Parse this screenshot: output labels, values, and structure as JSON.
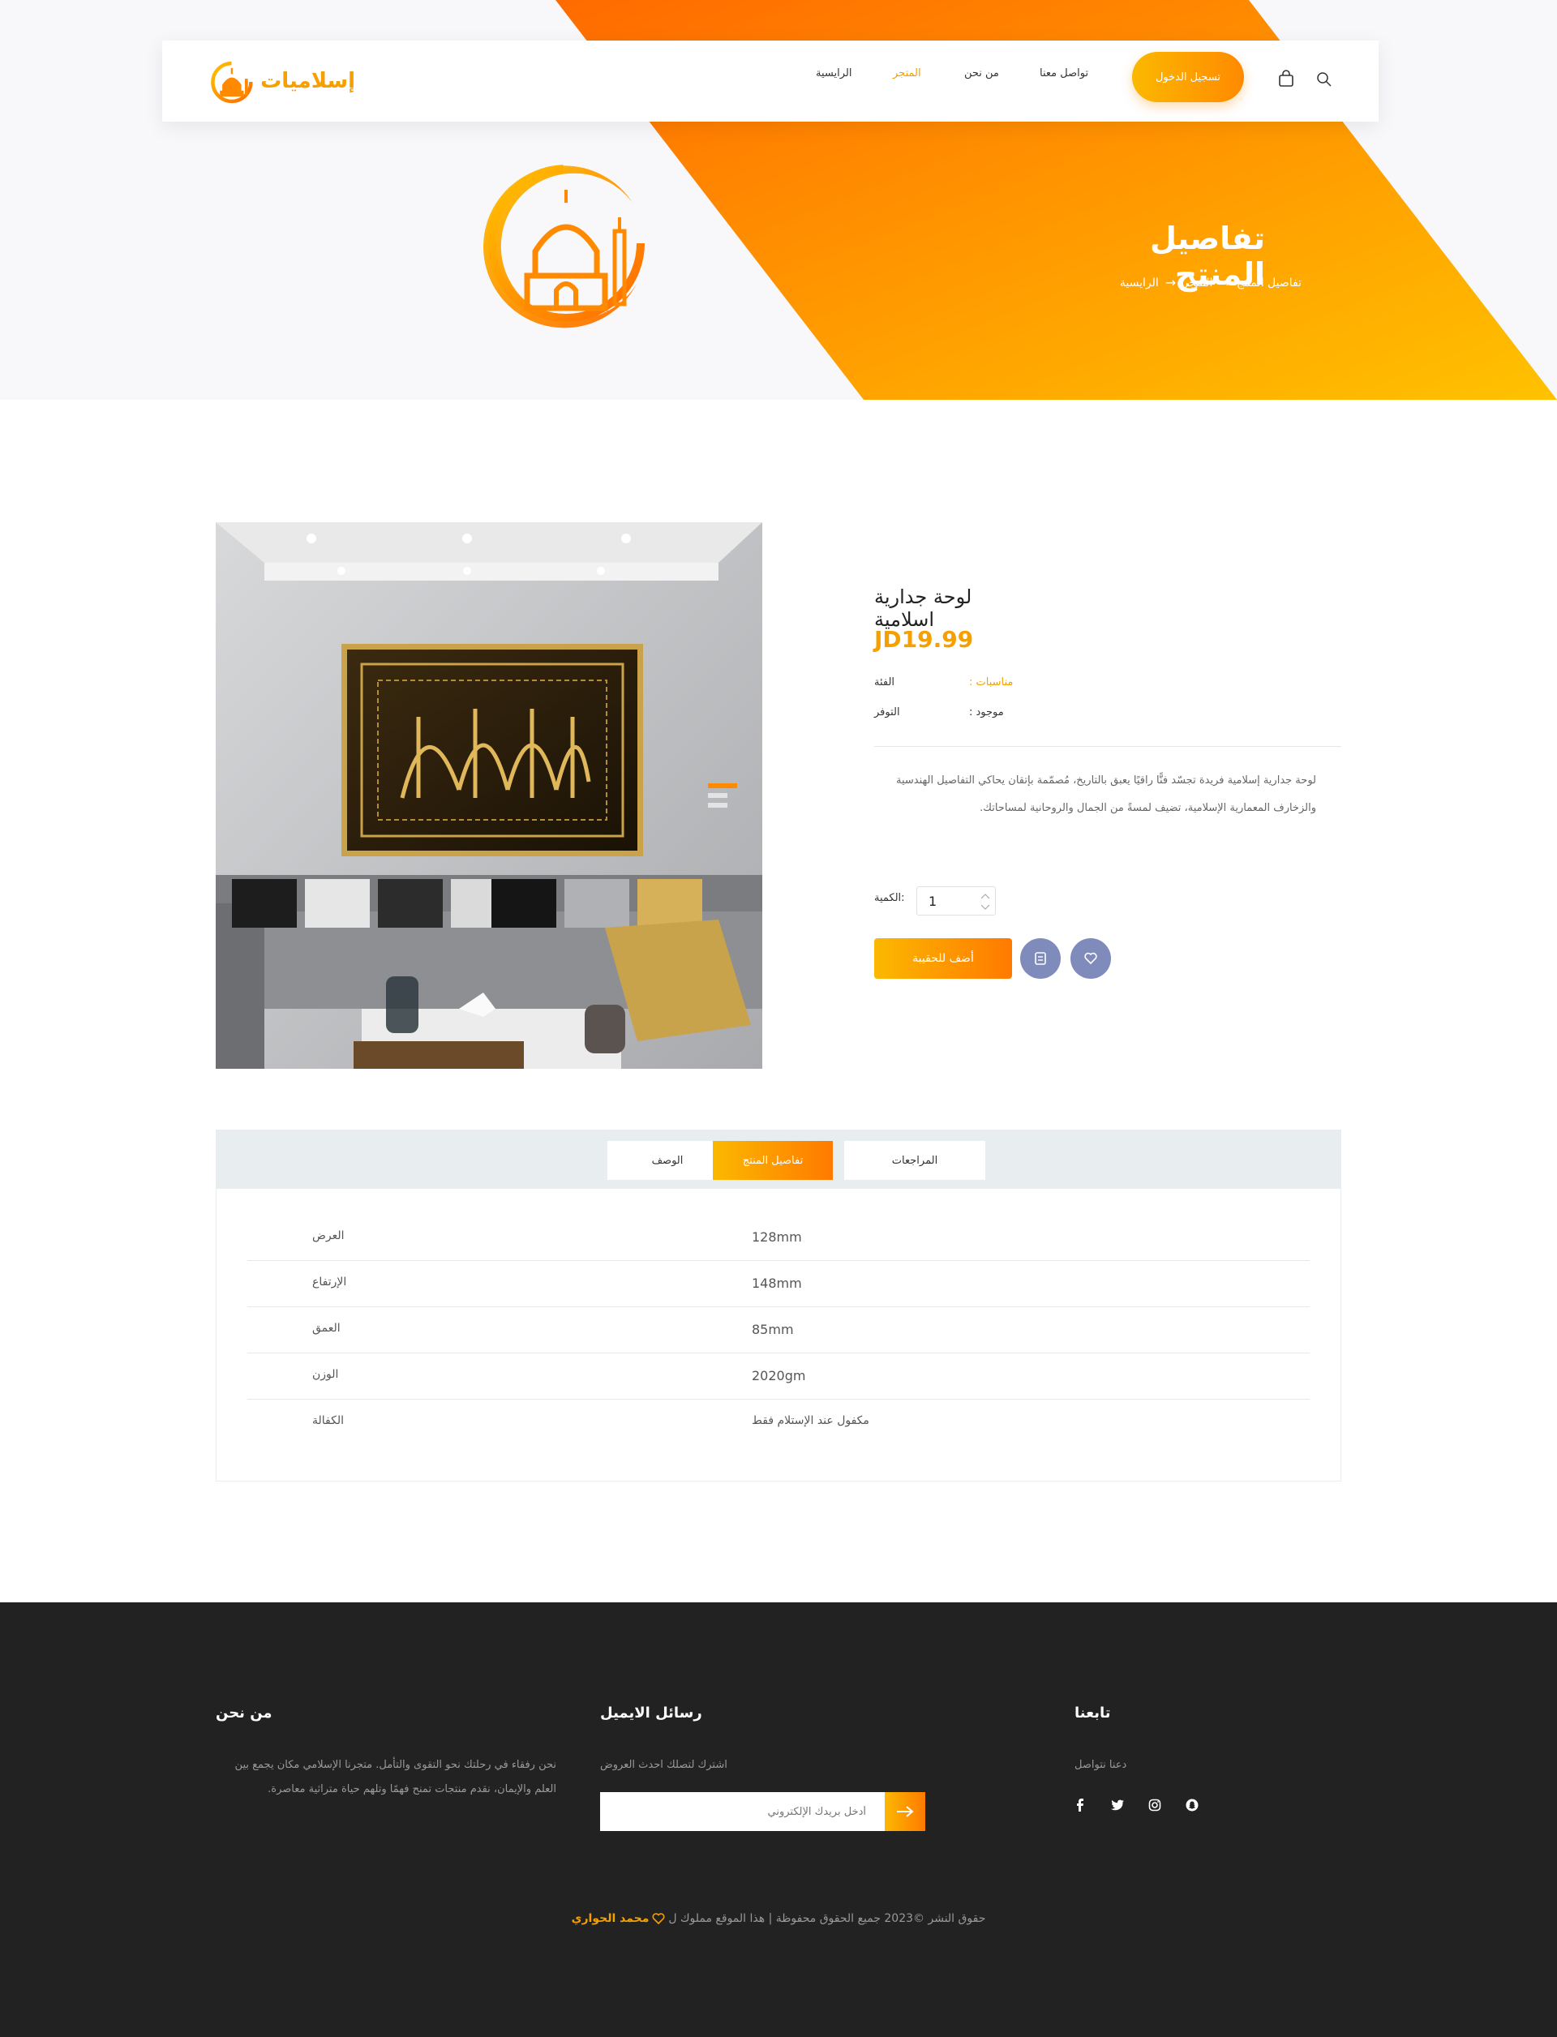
{
  "brand": {
    "logo_text": "إسلاميات"
  },
  "nav": {
    "home": "الرايسية",
    "shop": "المتجر",
    "about": "من نحن",
    "contact": "تواصل معنا",
    "login": "تسجيل الدخول"
  },
  "hero": {
    "title": "تفاصيل المنتج",
    "breadcrumb": [
      "الرايسية",
      "المتجر",
      "تفاصيل المنتج"
    ]
  },
  "product": {
    "title": "لوحة جدارية اسلامية",
    "price": "JD19.99",
    "category_label": "الفئة",
    "category_value": "مناسبات :",
    "availability_label": "التوفر",
    "availability_value": "موجود :",
    "description": "لوحة جدارية إسلامية فريدة تجسّد فنًّا راقيًا يعبق بالتاريخ، مُصمّمة بإتقان يحاكي التفاصيل الهندسية والزخارف المعمارية الإسلامية، تضيف لمسةً من الجمال والروحانية لمساحاتك.",
    "quantity_label": ":الكمية",
    "quantity_value": "1",
    "add_to_cart": "أضف للحقيبة"
  },
  "tabs": {
    "description": "الوصف",
    "details": "تفاصيل المنتج",
    "reviews": "المراجعات"
  },
  "specs": [
    {
      "label": "العرض",
      "value": "128mm"
    },
    {
      "label": "الإرتفاع",
      "value": "148mm"
    },
    {
      "label": "العمق",
      "value": "85mm"
    },
    {
      "label": "الوزن",
      "value": "2020gm"
    },
    {
      "label": "الكفالة",
      "value": "مكفول عند الإستلام فقط"
    }
  ],
  "footer": {
    "about_title": "من نحن",
    "about_text": "نحن رفقاء في رحلتك نحو التقوى والتأمل. متجرنا الإسلامي مكان يجمع بين العلم والإيمان، نقدم منتجات تمنح فهمًا وتلهم حياة متراثية معاصرة.",
    "newsletter_title": "رسائل الايميل",
    "newsletter_text": "اشترك لتصلك احدث العروض",
    "newsletter_placeholder": "أدخل بريدك الإلكتروني",
    "follow_title": "تابعنا",
    "follow_text": "دعنا نتواصل",
    "copyright_text": "حقوق النشر ©2023 جميع الحقوق محفوظة | هذا الموقع مملوك ل",
    "author": "محمد الحواري"
  },
  "colors": {
    "accent": "#f5a000",
    "gradient_start": "#fbb800",
    "gradient_end": "#ff7a00",
    "footer_bg": "#222222",
    "tab_bar": "#e8eef0",
    "icon_button": "#7f8bba"
  }
}
